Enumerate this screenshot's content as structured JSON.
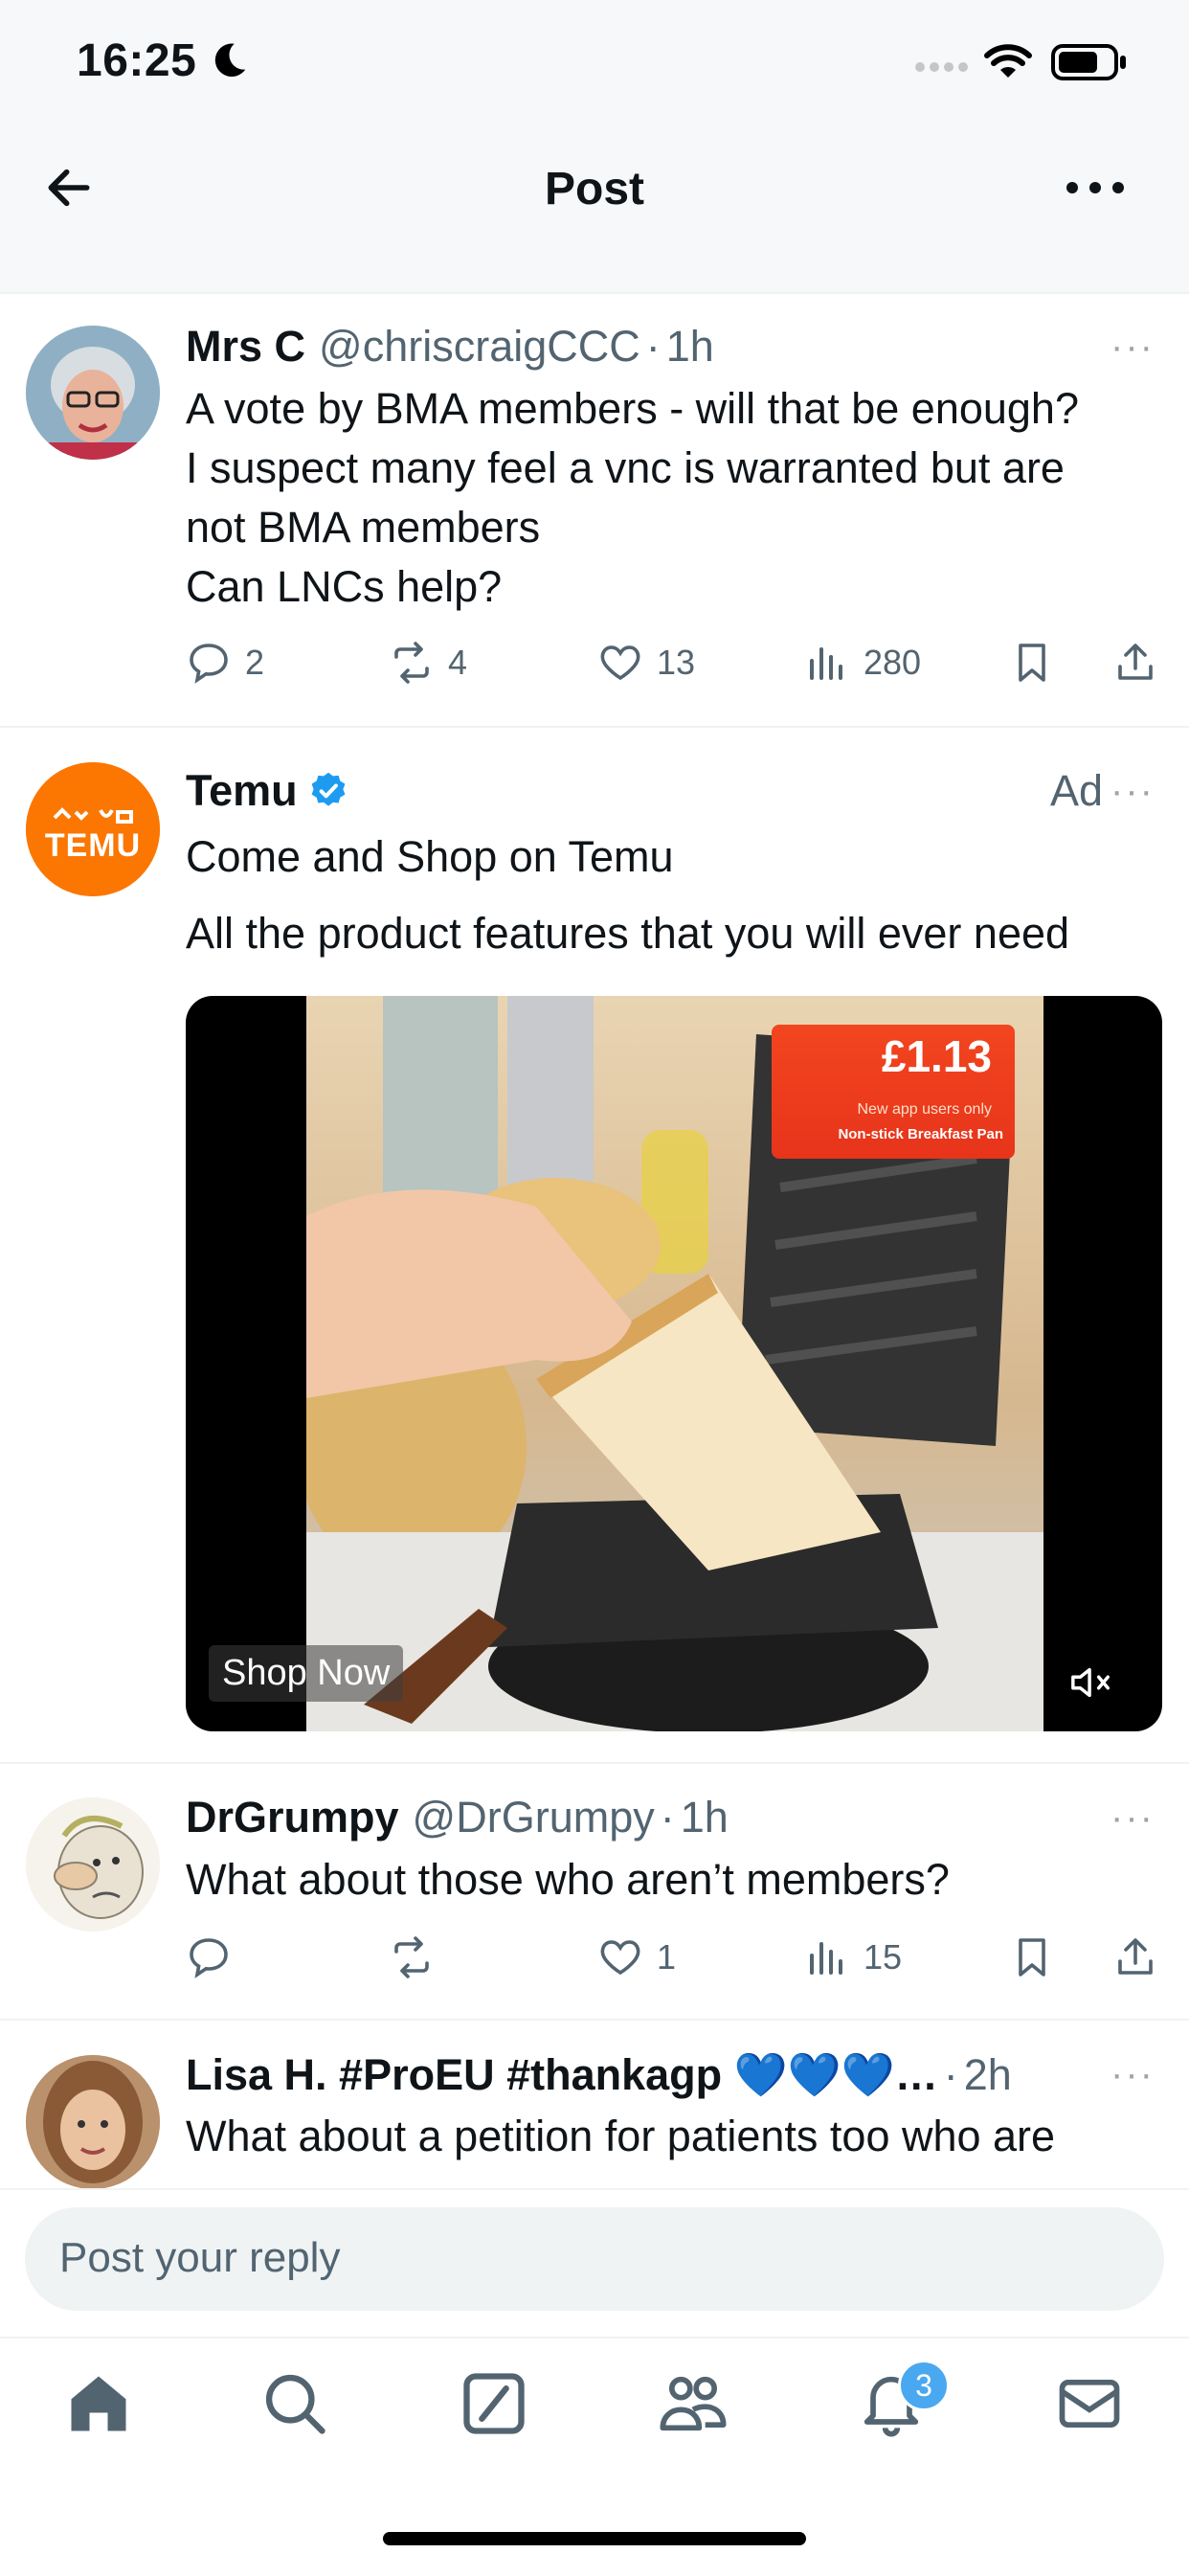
{
  "status_bar": {
    "time": "16:25"
  },
  "header": {
    "title": "Post"
  },
  "posts": [
    {
      "name": "Mrs C",
      "handle": "@chriscraigCCC",
      "sep": "·",
      "time": "1h",
      "text_lines": [
        "A vote by BMA members - will that be enough?",
        "I suspect many feel a vnc is warranted but are",
        "not BMA members",
        "Can LNCs help?"
      ],
      "replies": "2",
      "reposts": "4",
      "likes": "13",
      "views": "280"
    },
    {
      "name": "DrGrumpy",
      "handle": "@DrGrumpy",
      "sep": "·",
      "time": "1h",
      "text_lines": [
        "What about those who aren’t members?"
      ],
      "replies": "",
      "reposts": "",
      "likes": "1",
      "views": "15"
    },
    {
      "name": "Lisa H. #ProEU #thankagp 💙💙💙…",
      "sep": "·",
      "time": "2h",
      "text_lines": [
        "What about a petition for patients too who are"
      ]
    }
  ],
  "ad": {
    "name": "Temu",
    "ad_label": "Ad",
    "logo_text": "TEMU",
    "line1": "Come and Shop on Temu",
    "line2": "All the product features that you will ever need",
    "price": "£1.13",
    "price_sub": "New app users only",
    "price_caption": "Non-stick Breakfast Pan",
    "cta": "Shop Now"
  },
  "reply_box": {
    "placeholder": "Post your reply"
  },
  "tabbar": {
    "notification_count": "3"
  },
  "colors": {
    "accent": "#1d9bf0",
    "temu_orange": "#fb7701",
    "muted_text": "#536471"
  }
}
